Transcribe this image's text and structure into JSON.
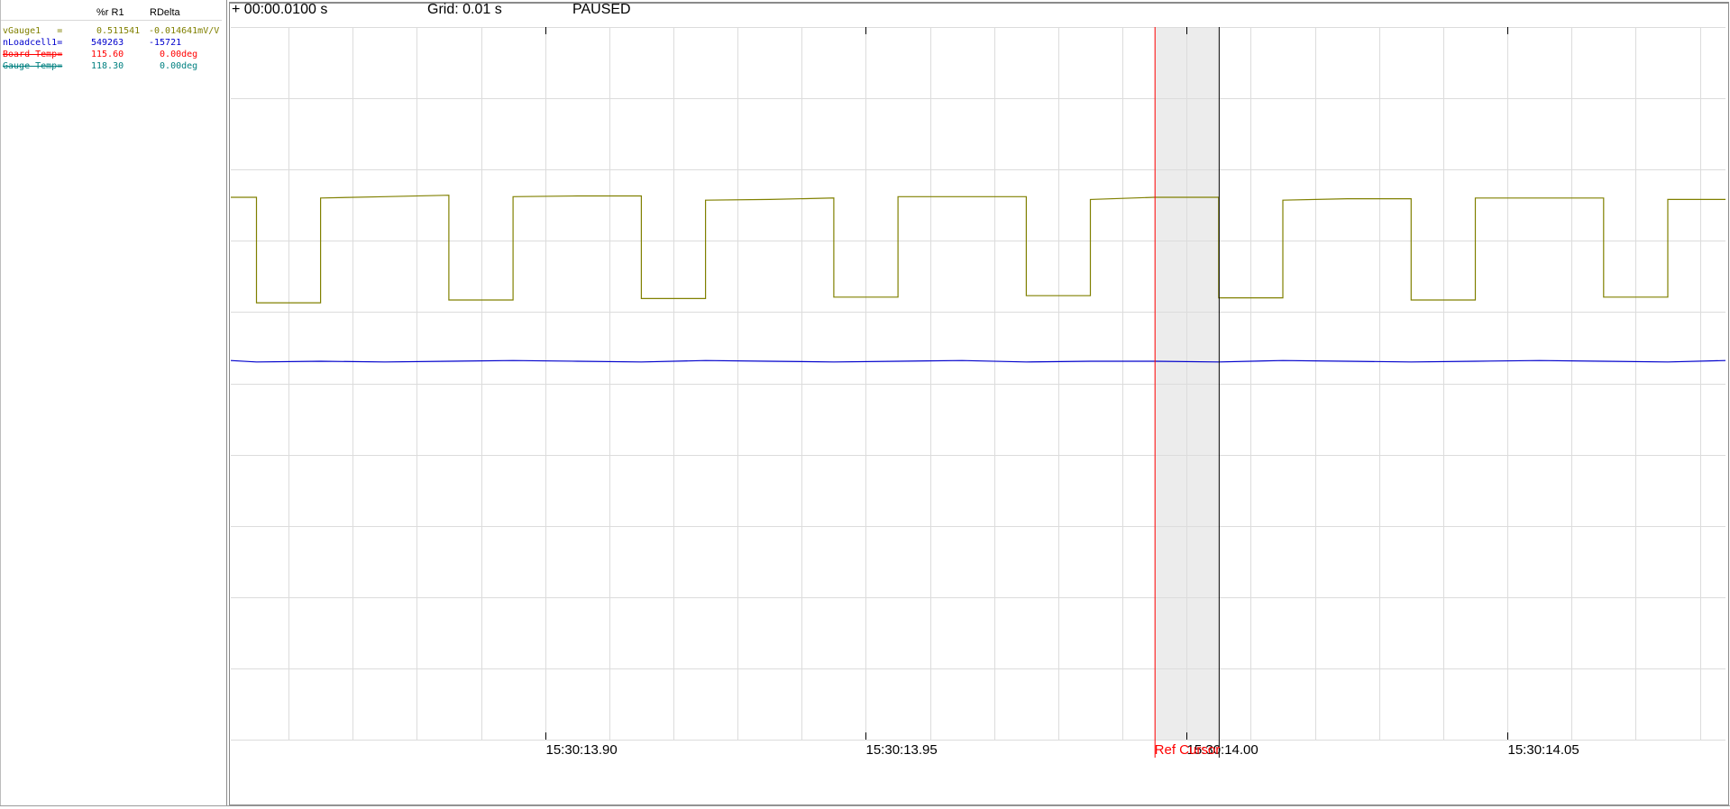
{
  "left_panel": {
    "col_r1": "%r R1",
    "col_rdelta": "RDelta",
    "channels": [
      {
        "name": "vGauge1   =",
        "r1": " 0.511541",
        "rdelta": "-0.014641mV/V",
        "color": "#808000",
        "strike": false
      },
      {
        "name": "nLoadcell1=",
        "r1": "549263",
        "rdelta": "-15721",
        "color": "#0000cc",
        "strike": false
      },
      {
        "name": "Board Temp=",
        "r1": "115.60",
        "rdelta": "  0.00deg",
        "color": "#ff0000",
        "strike": true
      },
      {
        "name": "Gauge Temp=",
        "r1": "118.30",
        "rdelta": "  0.00deg",
        "color": "#008080",
        "strike": true
      }
    ]
  },
  "topbar": {
    "offset": "+ 00:00.0100 s",
    "grid": "Grid: 0.01 s",
    "status": "PAUSED"
  },
  "chart_data": {
    "type": "line",
    "x_axis": {
      "major_ticks": [
        13.9,
        13.95,
        14.0,
        14.05
      ],
      "tick_labels": [
        "15:30:13.90",
        "15:30:13.95",
        "15:30:14.00",
        "15:30:14.05"
      ],
      "range": [
        13.851,
        14.084
      ],
      "minor_grid_step": 0.01
    },
    "y_axis": {
      "range": [
        -10,
        0
      ],
      "gridlines": 10
    },
    "series": [
      {
        "color": "#808000",
        "x": [
          13.851,
          13.855,
          13.855,
          13.865,
          13.865,
          13.875,
          13.885,
          13.885,
          13.895,
          13.895,
          13.905,
          13.915,
          13.915,
          13.925,
          13.925,
          13.935,
          13.945,
          13.945,
          13.955,
          13.955,
          13.965,
          13.975,
          13.975,
          13.985,
          13.985,
          13.995,
          14.005,
          14.005,
          14.015,
          14.015,
          14.025,
          14.035,
          14.035,
          14.045,
          14.045,
          14.055,
          14.065,
          14.065,
          14.075,
          14.075,
          14.084
        ],
        "y": [
          -2.39,
          -2.39,
          -3.87,
          -3.87,
          -2.4,
          -2.38,
          -2.36,
          -3.83,
          -3.83,
          -2.38,
          -2.37,
          -2.37,
          -3.81,
          -3.81,
          -2.43,
          -2.42,
          -2.4,
          -3.79,
          -3.79,
          -2.38,
          -2.38,
          -2.38,
          -3.77,
          -3.77,
          -2.42,
          -2.39,
          -2.39,
          -3.8,
          -3.8,
          -2.43,
          -2.41,
          -2.41,
          -3.83,
          -3.83,
          -2.4,
          -2.4,
          -2.4,
          -3.79,
          -3.79,
          -2.42,
          -2.42
        ]
      },
      {
        "color": "#0000cc",
        "x": [
          13.851,
          13.855,
          13.865,
          13.875,
          13.885,
          13.895,
          13.905,
          13.915,
          13.925,
          13.935,
          13.945,
          13.955,
          13.965,
          13.975,
          13.985,
          13.995,
          14.005,
          14.015,
          14.025,
          14.035,
          14.045,
          14.055,
          14.065,
          14.075,
          14.084
        ],
        "y": [
          -4.68,
          -4.7,
          -4.69,
          -4.7,
          -4.69,
          -4.68,
          -4.69,
          -4.7,
          -4.68,
          -4.69,
          -4.7,
          -4.69,
          -4.68,
          -4.7,
          -4.69,
          -4.69,
          -4.7,
          -4.68,
          -4.69,
          -4.7,
          -4.69,
          -4.68,
          -4.69,
          -4.7,
          -4.68
        ]
      }
    ],
    "ref_cursor": {
      "label": "Ref Cursor",
      "x": 13.995,
      "color": "#ff0000"
    },
    "cursor": {
      "x": 14.005
    }
  }
}
